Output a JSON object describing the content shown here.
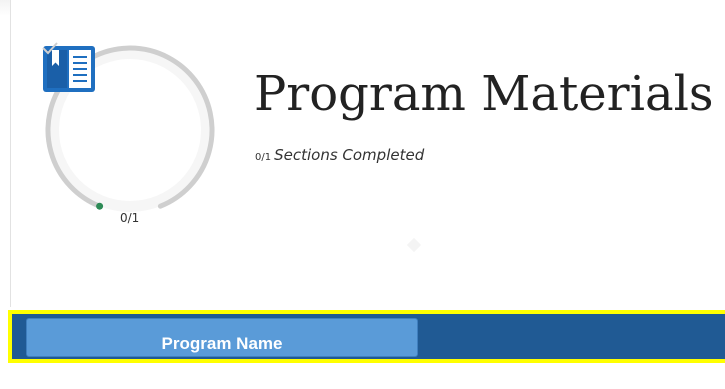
{
  "header": {
    "title": "Program Materials",
    "progress_fraction": "0/1",
    "progress_text": "Sections Completed",
    "completed": 0,
    "total": 1
  },
  "gauge": {
    "count_label": "0/1",
    "icon": "book-icon",
    "status_icon": "check-icon"
  },
  "bar": {
    "program_name_label": "Program Name"
  },
  "colors": {
    "accent": "#205a94",
    "button": "#5a9bd8",
    "highlight": "#ffff00",
    "book": "#1f6fc0",
    "ring": "#c9c9c9",
    "dot": "#2e8b57"
  }
}
